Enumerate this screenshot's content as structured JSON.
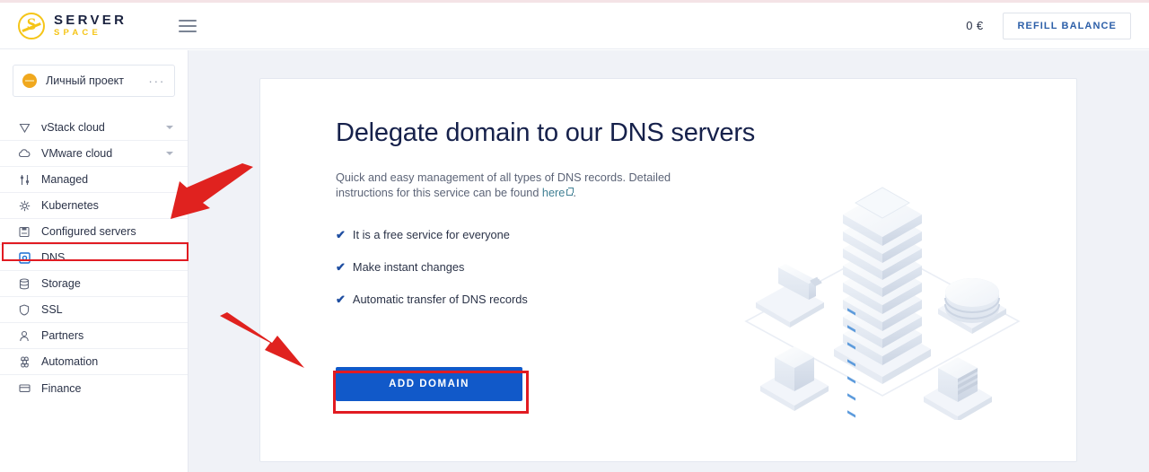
{
  "header": {
    "logo": {
      "mark_letter": "S",
      "primary": "SERVER",
      "secondary": "SPACE",
      "mark_color": "#f5c518",
      "primary_color": "#1b2340"
    },
    "menu_icon": "hamburger-menu-icon",
    "balance": "0 €",
    "refill_label": "REFILL BALANCE"
  },
  "sidebar": {
    "project": {
      "name": "Личный проект",
      "avatar_color": "#f0a81e",
      "more_label": "···"
    },
    "items": [
      {
        "label": "vStack cloud",
        "icon": "triangle-down-icon",
        "expandable": true,
        "active": false
      },
      {
        "label": "VMware cloud",
        "icon": "cloud-icon",
        "expandable": true,
        "active": false
      },
      {
        "label": "Managed",
        "icon": "sliders-icon",
        "expandable": false,
        "active": false
      },
      {
        "label": "Kubernetes",
        "icon": "kubernetes-helm-icon",
        "expandable": false,
        "active": false
      },
      {
        "label": "Configured servers",
        "icon": "server-preset-icon",
        "expandable": false,
        "active": false
      },
      {
        "label": "DNS",
        "icon": "dns-square-icon",
        "expandable": false,
        "active": true
      },
      {
        "label": "Storage",
        "icon": "database-icon",
        "expandable": false,
        "active": false
      },
      {
        "label": "SSL",
        "icon": "shield-icon",
        "expandable": false,
        "active": false
      },
      {
        "label": "Partners",
        "icon": "user-icon",
        "expandable": false,
        "active": false
      },
      {
        "label": "Automation",
        "icon": "command-icon",
        "expandable": false,
        "active": false
      },
      {
        "label": "Finance",
        "icon": "credit-card-icon",
        "expandable": false,
        "active": false
      }
    ]
  },
  "main": {
    "title": "Delegate domain to our DNS servers",
    "lead_before": "Quick and easy management of all types of DNS records. Detailed instructions for this service can be found ",
    "lead_link": "here",
    "lead_after": ".",
    "features": [
      {
        "check": "✔",
        "text": "It is a free service for everyone"
      },
      {
        "check": "✔",
        "text": "Make instant changes"
      },
      {
        "check": "✔",
        "text": "Automatic transfer of DNS records"
      }
    ],
    "add_domain_label": "ADD DOMAIN",
    "add_domain_color": "#1159c9",
    "illustration": "isometric-server-rack-illustration"
  },
  "annotations": {
    "highlight_color": "#e11b22",
    "dns_rect": "dns-sidebar-highlight",
    "button_rect": "add-domain-highlight",
    "arrow_to_dns": "red-arrow-pointing-to-dns",
    "arrow_to_button": "red-arrow-pointing-to-add-domain"
  }
}
